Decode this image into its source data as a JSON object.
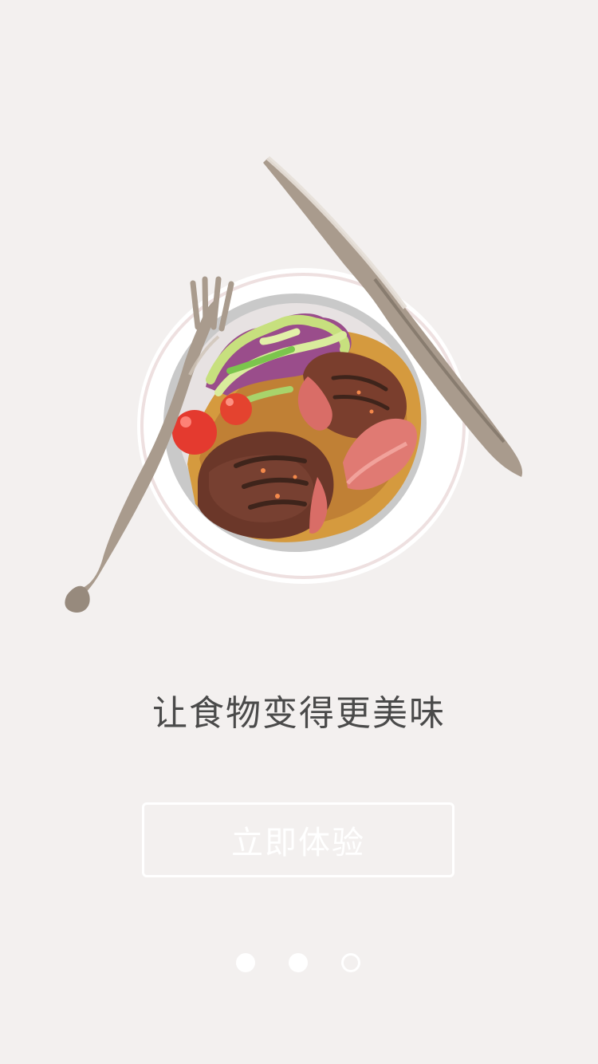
{
  "screen": {
    "headline": "让食物变得更美味",
    "cta_label": "立即体验"
  },
  "illustration": {
    "icon": "steak-plate-illustration",
    "items": [
      "fork-icon",
      "knife-icon",
      "plate-icon",
      "steak-icon",
      "salad-icon",
      "tomato-icon"
    ]
  },
  "pager": {
    "count": 3,
    "active_index": 2
  },
  "colors": {
    "background": "#f3f0ef",
    "headline": "#4a4a4a",
    "button_border": "#ffffff",
    "button_text": "#ffffff",
    "dot": "#ffffff"
  }
}
